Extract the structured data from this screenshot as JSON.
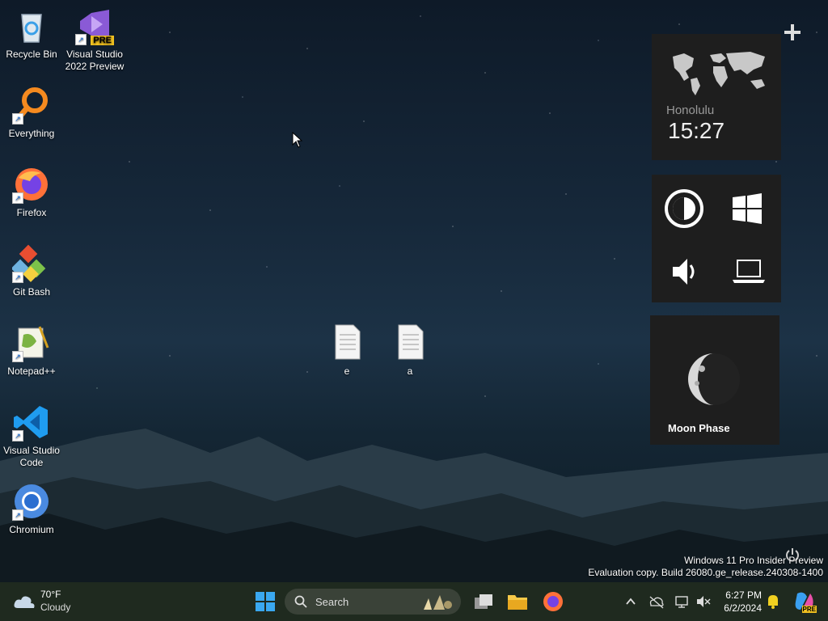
{
  "desktop": {
    "icons": [
      {
        "label": "Recycle Bin"
      },
      {
        "label": "Visual Studio 2022 Preview",
        "badge": "PRE"
      },
      {
        "label": "Everything"
      },
      {
        "label": "Firefox"
      },
      {
        "label": "Git Bash"
      },
      {
        "label": "Notepad++"
      },
      {
        "label": "Visual Studio Code"
      },
      {
        "label": "Chromium"
      }
    ],
    "files": [
      {
        "label": "e"
      },
      {
        "label": "a"
      }
    ]
  },
  "gadgets": {
    "add_icon": "plus-icon",
    "clock": {
      "city": "Honolulu",
      "time": "15:27"
    },
    "controls": {
      "icons": [
        "brightness-icon",
        "windows-icon",
        "volume-icon",
        "laptop-icon"
      ]
    },
    "moon": {
      "label": "Moon Phase"
    }
  },
  "watermark": {
    "line1": "Windows 11 Pro Insider Preview",
    "line2": "Evaluation copy. Build 26080.ge_release.240308-1400"
  },
  "taskbar": {
    "weather": {
      "temp": "70°F",
      "condition": "Cloudy"
    },
    "search": {
      "placeholder": "Search"
    },
    "clock": {
      "time": "6:27 PM",
      "date": "6/2/2024"
    },
    "copilot_badge": "PRE"
  },
  "colors": {
    "accent": "#0078d4",
    "gadget_bg": "#1e1e1e",
    "taskbar_bg": "#1f2a1f"
  }
}
